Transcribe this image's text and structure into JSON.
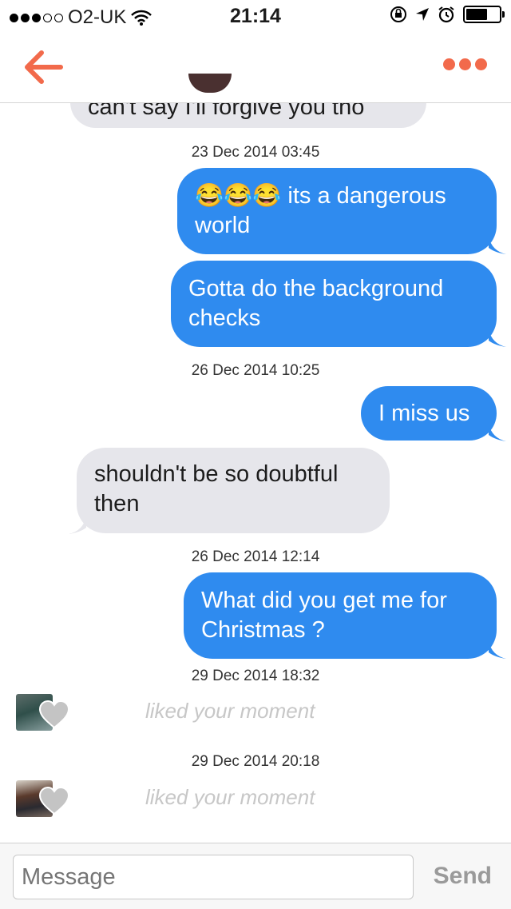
{
  "status_bar": {
    "carrier": "O2-UK",
    "time": "21:14"
  },
  "colors": {
    "accent": "#f26a4b",
    "outgoing_bubble": "#2f8bef",
    "incoming_bubble": "#e6e6eb"
  },
  "messages": {
    "partial_top": "can't say I'll forgive you tho",
    "ts1": "23 Dec 2014 03:45",
    "m1_line1": "its a dangerous",
    "m1_line2": "world",
    "m1_emoji": "😂😂😂",
    "m2_line1": "Gotta do the background",
    "m2_line2": "checks",
    "ts2": "26 Dec 2014 10:25",
    "m3": "I miss us",
    "m4_line1": "shouldn't be so doubtful",
    "m4_line2": "then",
    "ts3": "26 Dec 2014 12:14",
    "m5_line1": "What did you get me for",
    "m5_line2": "Christmas  ?",
    "ts4": "29 Dec 2014 18:32",
    "liked1": "liked your moment",
    "ts5": "29 Dec 2014 20:18",
    "liked2": "liked your moment"
  },
  "composer": {
    "placeholder": "Message",
    "send_label": "Send"
  }
}
